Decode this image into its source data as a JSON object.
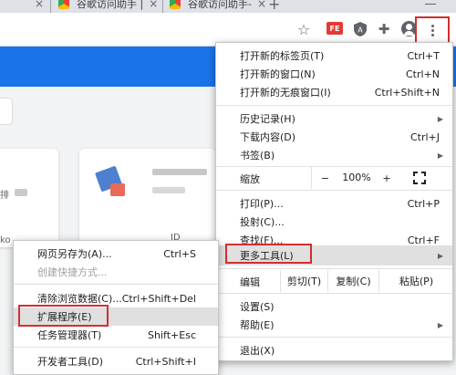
{
  "tabs": [
    {
      "close": "×"
    },
    {
      "title": "谷歌访问助手 |",
      "close": "×"
    },
    {
      "title": "谷歌访问助手-",
      "close": "×"
    }
  ],
  "new_tab_symbol": "+",
  "toolbar": {
    "star_icon": "☆",
    "extension_badge": "FE",
    "shield_label": "A",
    "puzzle_icon": "✚"
  },
  "page": {
    "snippet_left": "排",
    "snippet_left2": "ko",
    "snippet_card": "ID"
  },
  "main_menu": {
    "items": [
      {
        "label": "打开新的标签页(T)",
        "shortcut": "Ctrl+T"
      },
      {
        "label": "打开新的窗口(N)",
        "shortcut": "Ctrl+N"
      },
      {
        "label": "打开新的无痕窗口(I)",
        "shortcut": "Ctrl+Shift+N"
      },
      {
        "label": "历史记录(H)"
      },
      {
        "label": "下载内容(D)",
        "shortcut": "Ctrl+J"
      },
      {
        "label": "书签(B)"
      },
      {
        "label": "打印(P)...",
        "shortcut": "Ctrl+P"
      },
      {
        "label": "投射(C)..."
      },
      {
        "label": "查找(F)...",
        "shortcut": "Ctrl+F"
      },
      {
        "label": "更多工具(L)"
      },
      {
        "label": "设置(S)"
      },
      {
        "label": "帮助(E)"
      },
      {
        "label": "退出(X)"
      }
    ],
    "zoom": {
      "label": "缩放",
      "minus": "−",
      "value": "100%",
      "plus": "+"
    },
    "edit": {
      "label": "编辑",
      "cut": "剪切(T)",
      "copy": "复制(C)",
      "paste": "粘贴(P)"
    }
  },
  "sub_menu": {
    "items": [
      {
        "label": "网页另存为(A)...",
        "shortcut": "Ctrl+S"
      },
      {
        "label": "创建快捷方式..."
      },
      {
        "label": "清除浏览数据(C)...",
        "shortcut": "Ctrl+Shift+Del"
      },
      {
        "label": "扩展程序(E)"
      },
      {
        "label": "任务管理器(T)",
        "shortcut": "Shift+Esc"
      },
      {
        "label": "开发者工具(D)",
        "shortcut": "Ctrl+Shift+I"
      }
    ]
  },
  "colors": {
    "highlight_frame": "#d32f2f",
    "brand_band": "#1a73e8"
  }
}
